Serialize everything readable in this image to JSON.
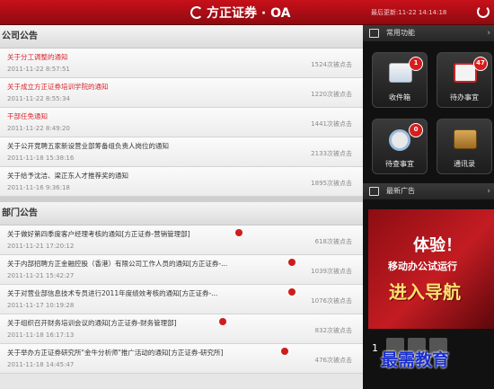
{
  "header": {
    "logo_text": "方正证券 · OA",
    "last_update": "最后更新:11-22 14:14:18"
  },
  "company": {
    "title": "公司公告",
    "items": [
      {
        "title": "关于分工调整的通知",
        "date": "2011-11-22 8:57:51",
        "clicks": "1524次被点击",
        "highlight": true
      },
      {
        "title": "关于成立方正证券培训学院的通知",
        "date": "2011-11-22 8:55:34",
        "clicks": "1220次被点击",
        "highlight": true
      },
      {
        "title": "干部任免通知",
        "date": "2011-11-22 8:49:20",
        "clicks": "1441次被点击",
        "highlight": true
      },
      {
        "title": "关于公开竞聘五家新设营业部筹备组负责人岗位的通知",
        "date": "2011-11-18 15:38:16",
        "clicks": "2133次被点击",
        "highlight": false
      },
      {
        "title": "关于给予沈洁、梁正东人才推荐奖的通知",
        "date": "2011-11-16 9:36:18",
        "clicks": "1895次被点击",
        "highlight": false
      }
    ]
  },
  "department": {
    "title": "部门公告",
    "items": [
      {
        "title": "关于做好第四季度客户经理考核的通知[方正证券-营销管理部]",
        "date": "2011-11-21 17:20:12",
        "clicks": "618次被点击"
      },
      {
        "title": "关于内部招聘方正金融控股（香港）有限公司工作人员的通知[方正证券-...",
        "date": "2011-11-21 15:42:27",
        "clicks": "1039次被点击"
      },
      {
        "title": "关于对营业部信息技术专员进行2011年度绩效考核的通知[方正证券-...",
        "date": "2011-11-17 10:19:28",
        "clicks": "1076次被点击"
      },
      {
        "title": "关于组织召开财务培训会议的通知[方正证券-财务管理部]",
        "date": "2011-11-18 16:17:13",
        "clicks": "832次被点击"
      },
      {
        "title": "关于举办方正证券研究所\"金牛分析师\"推广活动的通知[方正证券-研究所]",
        "date": "2011-11-18 14:45:47",
        "clicks": "476次被点击"
      }
    ]
  },
  "sidebar": {
    "common_title": "常用功能",
    "tiles": [
      {
        "label": "收件箱",
        "badge": "1",
        "icon": "mail-icon"
      },
      {
        "label": "待办事宜",
        "badge": "47",
        "icon": "todo-check-icon"
      },
      {
        "label": "待查事宜",
        "badge": "0",
        "icon": "magnifier-icon"
      },
      {
        "label": "通讯录",
        "badge": "",
        "icon": "contacts-book-icon"
      }
    ],
    "ads_title": "最新广告",
    "ad": {
      "line1": "体验！",
      "line2": "移动办公试运行",
      "line3": "进入导航"
    },
    "pager_num": "1"
  },
  "watermark": "最需教育",
  "colors": {
    "brand_red": "#c8101a",
    "highlight_text": "#d8242a",
    "normal_text": "#333333"
  }
}
